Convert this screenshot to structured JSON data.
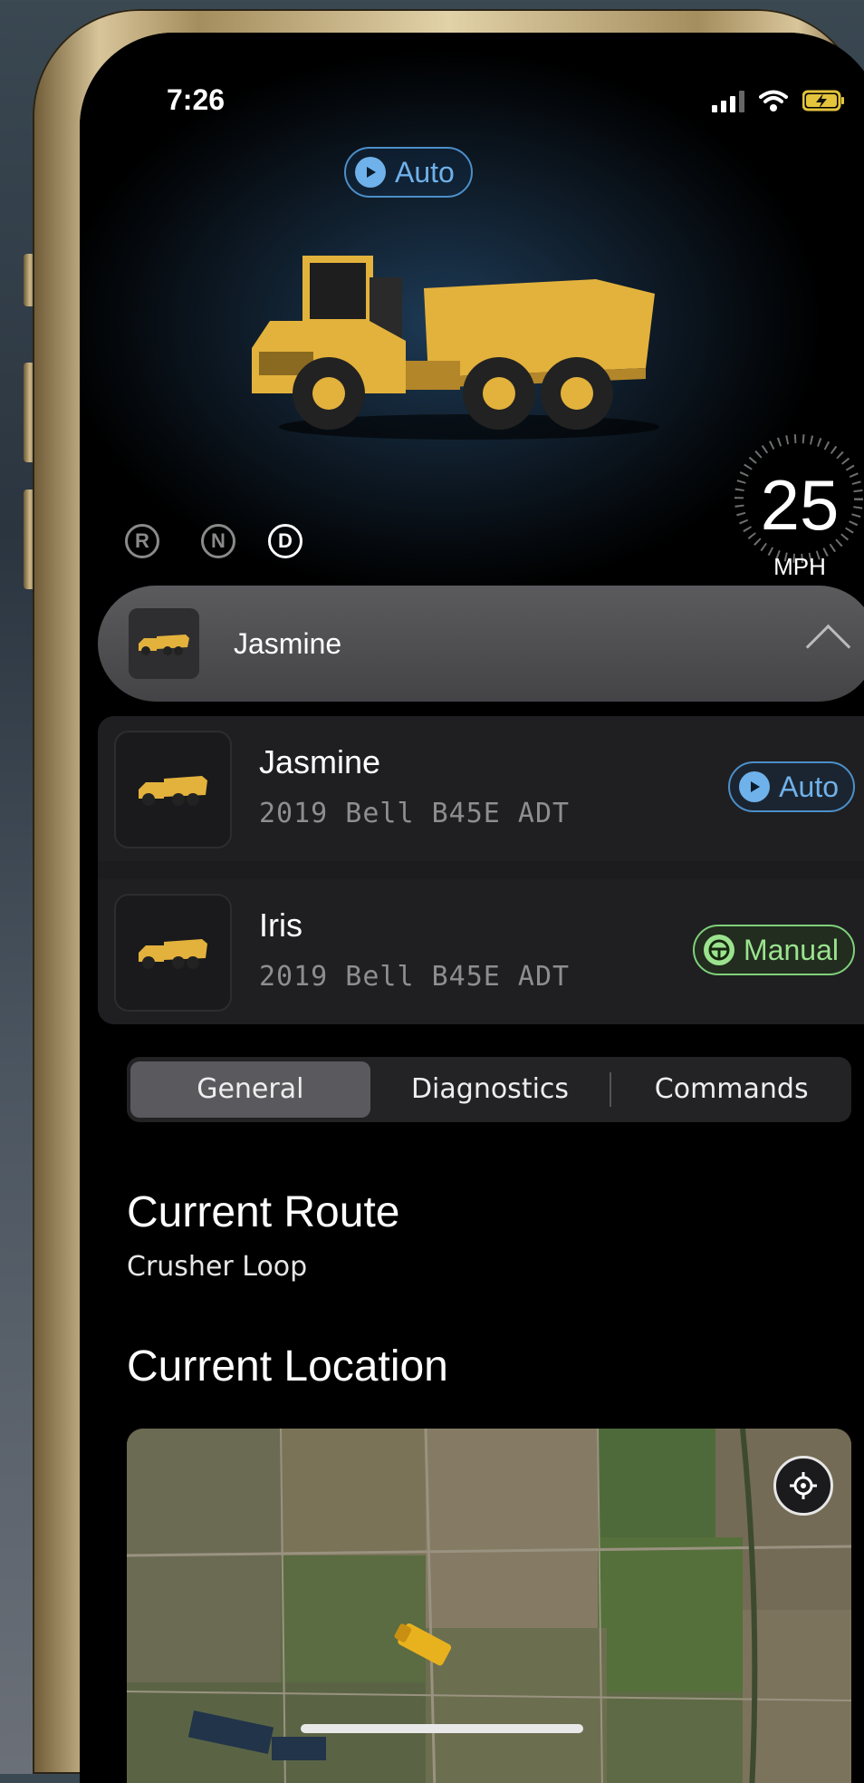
{
  "status_bar": {
    "time": "7:26"
  },
  "hero": {
    "mode_label": "Auto",
    "gears": [
      "R",
      "N",
      "D"
    ],
    "active_gear": "D",
    "speed": "25",
    "speed_unit": "MPH"
  },
  "vehicle_selector": {
    "name": "Jasmine"
  },
  "vehicles": [
    {
      "name": "Jasmine",
      "model": "2019 Bell B45E ADT",
      "mode": "Auto"
    },
    {
      "name": "Iris",
      "model": "2019 Bell B45E ADT",
      "mode": "Manual"
    }
  ],
  "tabs": [
    "General",
    "Diagnostics",
    "Commands"
  ],
  "active_tab": "General",
  "sections": {
    "route_title": "Current Route",
    "route_value": "Crusher Loop",
    "location_title": "Current Location"
  },
  "colors": {
    "auto": "#6fb1ea",
    "manual": "#9be38f",
    "truck": "#e3b23c"
  },
  "icons": [
    "signal-icon",
    "wifi-icon",
    "battery-charging-icon",
    "play-icon",
    "steering-wheel-icon",
    "chevron-up-icon",
    "recenter-icon"
  ]
}
